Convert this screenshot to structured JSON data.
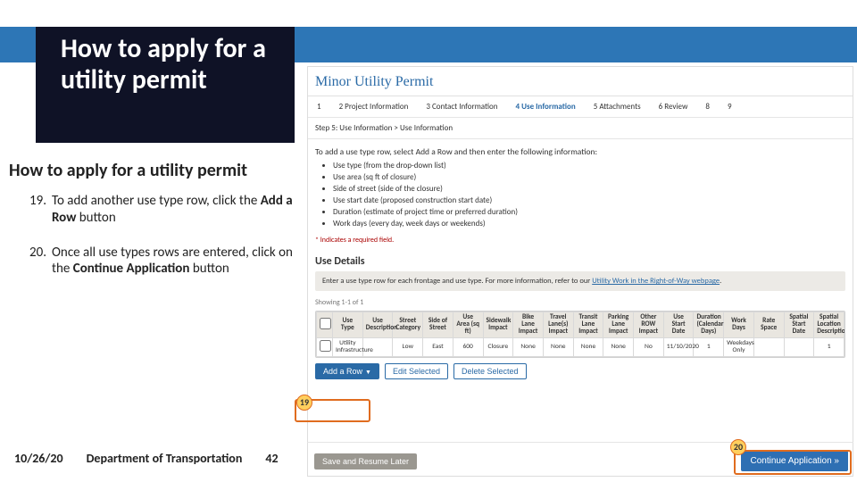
{
  "title": "How to apply for a utility permit",
  "subtitle": "How to apply for a utility permit",
  "steps": [
    {
      "index": "19.",
      "prefix": "To add another use type row, click the ",
      "bold": "Add a Row",
      "suffix": " button"
    },
    {
      "index": "20.",
      "prefix": "Once all use types rows are entered, click on the ",
      "bold": "Continue Application",
      "suffix": " button"
    }
  ],
  "footer": {
    "date": "10/26/20",
    "dept": "Department of Transportation",
    "page": "42"
  },
  "screenshot": {
    "app_title": "Minor Utility Permit",
    "wizard": [
      {
        "num": "1",
        "label": ""
      },
      {
        "num": "2",
        "label": "Project Information"
      },
      {
        "num": "3",
        "label": "Contact Information"
      },
      {
        "num": "4",
        "label": "Use Information"
      },
      {
        "num": "5",
        "label": "Attachments"
      },
      {
        "num": "6",
        "label": "Review"
      },
      {
        "num": "8",
        "label": ""
      },
      {
        "num": "9",
        "label": ""
      }
    ],
    "breadcrumb": "Step 5: Use Information > Use Information",
    "instr": "To add a use type row, select Add a Row and then enter the following information:",
    "bullets": [
      "Use type (from the drop-down list)",
      "Use area (sq ft of closure)",
      "Side of street (side of the closure)",
      "Use start date (proposed construction start date)",
      "Duration (estimate of project time or preferred duration)",
      "Work days (every day, week days or weekends)"
    ],
    "required_note": "* Indicates a required field.",
    "section_title": "Use Details",
    "gray_note_prefix": "Enter a use type row for each frontage and use type. For more information, refer to our ",
    "gray_note_link": "Utility Work in the Right-of-Way webpage",
    "gray_note_suffix": ".",
    "showing": "Showing 1-1 of 1",
    "headers": [
      "",
      "Use Type",
      "Use Description",
      "Street Category",
      "Side of Street",
      "Use Area (sq ft)",
      "Sidewalk Impact",
      "Bike Lane Impact",
      "Travel Lane(s) Impact",
      "Transit Lane Impact",
      "Parking Lane Impact",
      "Other ROW Impact",
      "Use Start Date",
      "Duration (Calendar Days)",
      "Work Days",
      "Rate Space",
      "Spatial Start Date",
      "Spatial Location Description"
    ],
    "row": [
      "",
      "Utility Infrastructure",
      "",
      "Low",
      "East",
      "600",
      "Closure",
      "None",
      "None",
      "None",
      "None",
      "No",
      "11/10/2020",
      "1",
      "Weekdays Only",
      "",
      "",
      "1"
    ],
    "add_row": "Add a Row",
    "edit_selected": "Edit Selected",
    "delete_selected": "Delete Selected",
    "save_later": "Save and Resume Later",
    "continue_btn": "Continue Application »"
  },
  "callouts": {
    "b19": "19",
    "b20": "20"
  }
}
